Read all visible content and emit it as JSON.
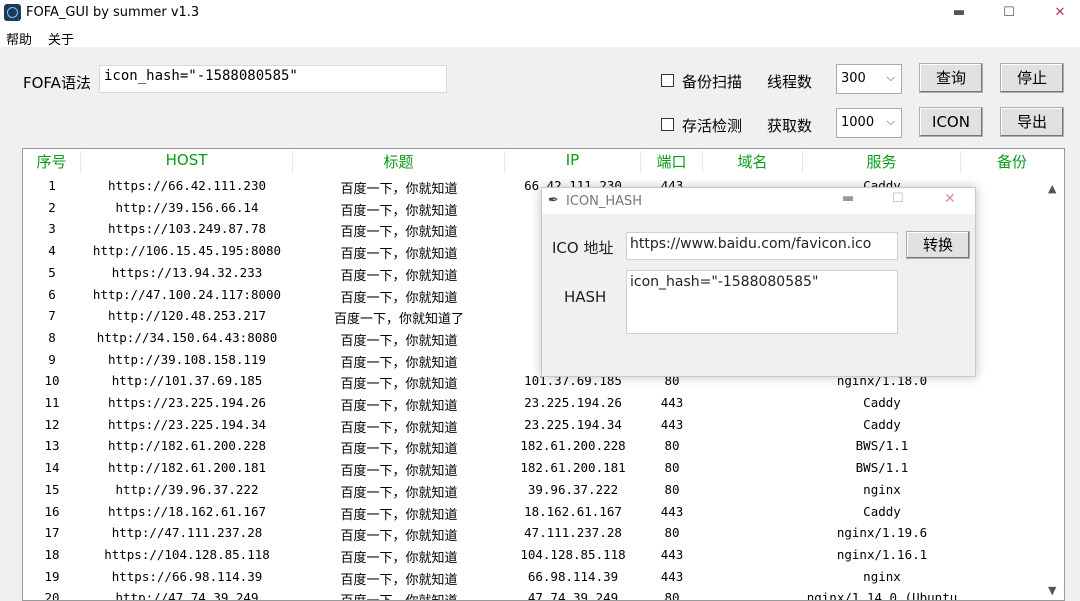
{
  "window": {
    "title": "FOFA_GUI  by summer v1.3",
    "min_glyph": "▬",
    "max_glyph": "☐",
    "close_glyph": "✕"
  },
  "menu": {
    "help": "帮助",
    "about": "关于"
  },
  "query": {
    "label": "FOFA语法",
    "value": "icon_hash=\"-1588080585\""
  },
  "options": {
    "backup_scan": "备份扫描",
    "alive_check": "存活检测",
    "threads_label": "线程数",
    "threads_value": "300",
    "fetch_label": "获取数",
    "fetch_value": "1000",
    "combo_arrow": "⌵"
  },
  "buttons": {
    "query": "查询",
    "stop": "停止",
    "icon": "ICON",
    "export": "导出"
  },
  "table": {
    "headers": [
      "序号",
      "HOST",
      "标题",
      "IP",
      "端口",
      "域名",
      "服务",
      "备份"
    ],
    "scroll_up": "▲",
    "scroll_down": "▼",
    "rows": [
      [
        "1",
        "https://66.42.111.230",
        "百度一下，你就知道",
        "66.42.111.230",
        "443",
        "",
        "Caddy"
      ],
      [
        "2",
        "http://39.156.66.14",
        "百度一下，你就知道",
        "39.",
        "",
        "",
        ""
      ],
      [
        "3",
        "https://103.249.87.78",
        "百度一下，你就知道",
        "10",
        "",
        "",
        ""
      ],
      [
        "4",
        "http://106.15.45.195:8080",
        "百度一下，你就知道",
        "10",
        "",
        "",
        ""
      ],
      [
        "5",
        "https://13.94.32.233",
        "百度一下，你就知道",
        "13",
        "",
        "",
        ""
      ],
      [
        "6",
        "http://47.100.24.117:8000",
        "百度一下，你就知道",
        "47",
        "",
        "",
        ""
      ],
      [
        "7",
        "http://120.48.253.217",
        "百度一下，你就知道了",
        "120",
        "",
        "",
        ""
      ],
      [
        "8",
        "http://34.150.64.43:8080",
        "百度一下，你就知道",
        "34",
        "",
        "",
        ""
      ],
      [
        "9",
        "http://39.108.158.119",
        "百度一下，你就知道",
        "39.",
        "",
        "",
        ""
      ],
      [
        "10",
        "http://101.37.69.185",
        "百度一下，你就知道",
        "101.37.69.185",
        "80",
        "",
        "nginx/1.18.0"
      ],
      [
        "11",
        "https://23.225.194.26",
        "百度一下，你就知道",
        "23.225.194.26",
        "443",
        "",
        "Caddy"
      ],
      [
        "12",
        "https://23.225.194.34",
        "百度一下，你就知道",
        "23.225.194.34",
        "443",
        "",
        "Caddy"
      ],
      [
        "13",
        "http://182.61.200.228",
        "百度一下，你就知道",
        "182.61.200.228",
        "80",
        "",
        "BWS/1.1"
      ],
      [
        "14",
        "http://182.61.200.181",
        "百度一下，你就知道",
        "182.61.200.181",
        "80",
        "",
        "BWS/1.1"
      ],
      [
        "15",
        "http://39.96.37.222",
        "百度一下，你就知道",
        "39.96.37.222",
        "80",
        "",
        "nginx"
      ],
      [
        "16",
        "https://18.162.61.167",
        "百度一下，你就知道",
        "18.162.61.167",
        "443",
        "",
        "Caddy"
      ],
      [
        "17",
        "http://47.111.237.28",
        "百度一下，你就知道",
        "47.111.237.28",
        "80",
        "",
        "nginx/1.19.6"
      ],
      [
        "18",
        "https://104.128.85.118",
        "百度一下，你就知道",
        "104.128.85.118",
        "443",
        "",
        "nginx/1.16.1"
      ],
      [
        "19",
        "https://66.98.114.39",
        "百度一下，你就知道",
        "66.98.114.39",
        "443",
        "",
        "nginx"
      ],
      [
        "20",
        "http://47.74.39.249",
        "百度一下，你就知道",
        "47.74.39.249",
        "80",
        "",
        "nginx/1.14.0 (Ubuntu"
      ]
    ]
  },
  "dialog": {
    "title": "ICON_HASH",
    "icon_glyph": "✒",
    "min_glyph": "▬",
    "max_glyph": "☐",
    "close_glyph": "✕",
    "ico_label": "ICO 地址",
    "ico_value": "https://www.baidu.com/favicon.ico",
    "convert_button": "转换",
    "hash_label": "HASH",
    "hash_value": "icon_hash=\"-1588080585\""
  }
}
